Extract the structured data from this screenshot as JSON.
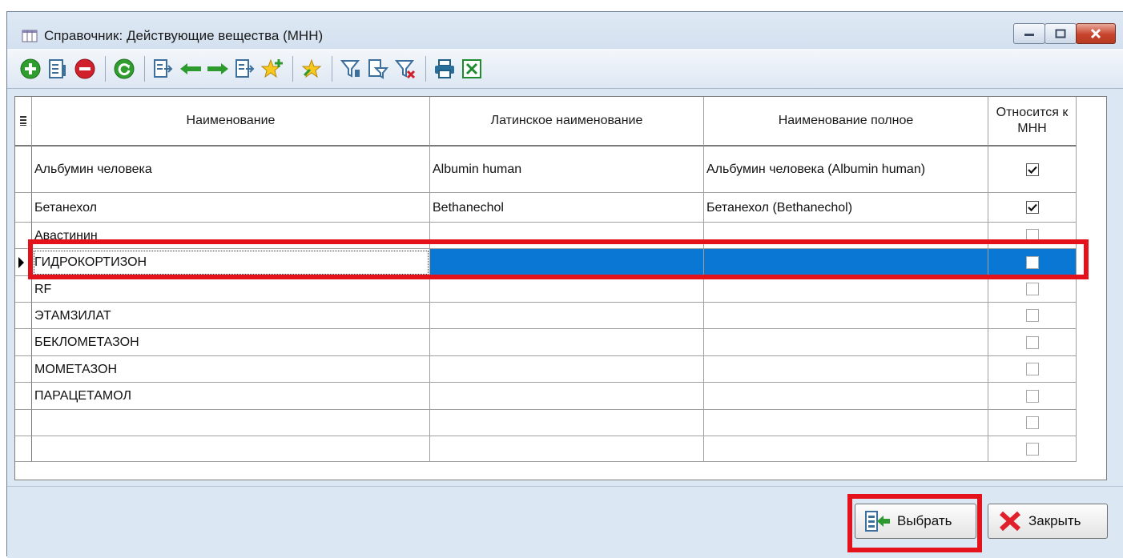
{
  "window": {
    "title": "Справочник: Действующие вещества (МНН)",
    "minimize_label": "minimize",
    "maximize_label": "maximize",
    "close_label": "close"
  },
  "toolbar": {
    "icons": [
      "add-icon",
      "edit-icon",
      "delete-icon",
      "refresh-icon",
      "move-icon",
      "arrow-left-icon",
      "arrow-right-icon",
      "move-icon-2",
      "star-add-icon",
      "star-icon",
      "filter-icon",
      "filter-edit-icon",
      "filter-clear-icon",
      "print-icon",
      "excel-icon"
    ]
  },
  "grid": {
    "columns": [
      "Наименование",
      "Латинское наименование",
      "Наименование полное",
      "Относится к МНН"
    ],
    "rows": [
      {
        "name": "Альбумин человека",
        "latin": "Albumin human",
        "full": "Альбумин человека (Albumin human)",
        "mnn": true
      },
      {
        "name": "Бетанехол",
        "latin": "Bethanechol",
        "full": "Бетанехол (Bethanechol)",
        "mnn": true
      },
      {
        "name": "Авастинин",
        "latin": "",
        "full": "",
        "mnn": false
      },
      {
        "name": "ГИДРОКОРТИЗОН",
        "latin": "",
        "full": "",
        "mnn": false,
        "selected": true
      },
      {
        "name": "RF",
        "latin": "",
        "full": "",
        "mnn": false
      },
      {
        "name": "ЭТАМЗИЛАТ",
        "latin": "",
        "full": "",
        "mnn": false
      },
      {
        "name": "БЕКЛОМЕТАЗОН",
        "latin": "",
        "full": "",
        "mnn": false
      },
      {
        "name": "МОМЕТАЗОН",
        "latin": "",
        "full": "",
        "mnn": false
      },
      {
        "name": "ПАРАЦЕТАМОЛ",
        "latin": "",
        "full": "",
        "mnn": false
      },
      {
        "name": "",
        "latin": "",
        "full": "",
        "mnn": false
      },
      {
        "name": "",
        "latin": "",
        "full": "",
        "mnn": false
      }
    ]
  },
  "buttons": {
    "select_label": "Выбрать",
    "close_label": "Закрыть"
  },
  "colors": {
    "selection": "#0a77d4",
    "highlight": "#e3121b"
  }
}
